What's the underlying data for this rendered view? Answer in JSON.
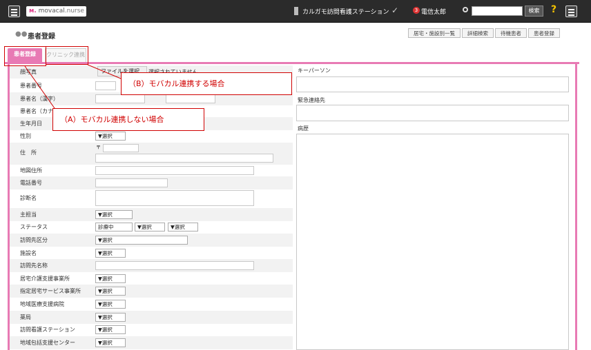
{
  "topbar": {
    "logo_mark": "ᴍ.",
    "logo_text": "movacal",
    "logo_sub": ".nurse",
    "station": "カルガモ訪問看護ステーション",
    "badge": "3",
    "user": "電信太郎",
    "search_button": "検索",
    "help": "?"
  },
  "header": {
    "title": "患者登録",
    "buttons": [
      "居宅・施設別一覧",
      "詳細検索",
      "待機患者",
      "患者登録"
    ]
  },
  "tabs": {
    "active": "患者登録",
    "inactive": "クリニック連携"
  },
  "form": {
    "photo_label": "顔写真",
    "file_button": "ファイルを選択",
    "file_status": "選択されていません",
    "labels": {
      "patient_no": "患者番号",
      "name_kanji": "患者名（漢字）",
      "name_kana": "患者名（カナ）",
      "birthday": "生年月日",
      "gender": "性別",
      "address": "住　所",
      "map_address": "地図住所",
      "phone": "電話番号",
      "diagnosis": "診断名",
      "staff": "主担当",
      "status": "ステータス",
      "visit_type": "訪問先区分",
      "facility": "施設名",
      "visit_name": "訪問先名称",
      "care_office": "居宅介護支援事業所",
      "service_office": "指定居宅サービス事業所",
      "hospital": "地域医療支援病院",
      "pharmacy": "薬局",
      "nursing_station": "訪問看護ステーション",
      "support_center": "地域包括支援センター"
    },
    "postal_mark": "〒",
    "select": "▼選択",
    "status_value": "診療中"
  },
  "right": {
    "keyperson": "キーパーソン",
    "emergency": "緊急連絡先",
    "history": "病歴"
  },
  "callouts": {
    "b": "（B）モバカル連携する場合",
    "a": "（A）モバカル連携しない場合"
  }
}
